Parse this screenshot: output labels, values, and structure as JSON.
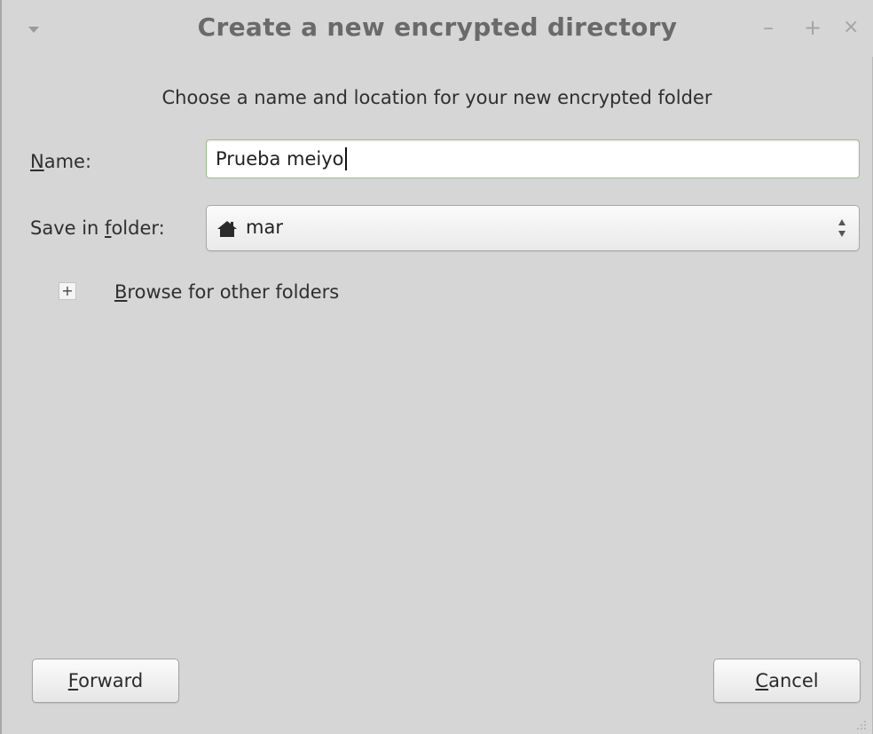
{
  "window": {
    "title": "Create a new encrypted directory",
    "controls": {
      "minimize": "–",
      "maximize": "+",
      "close": "×"
    }
  },
  "dialog": {
    "subtitle": "Choose a name and location for your new encrypted folder",
    "name_field": {
      "label_mnemonic": "N",
      "label_rest": "ame:",
      "value": "Prueba meiyo"
    },
    "folder_field": {
      "label_prefix": "Save in ",
      "label_mnemonic": "f",
      "label_rest": "older:",
      "selected": "mar",
      "icon": "home-icon"
    },
    "browse": {
      "expander": "+",
      "label_mnemonic": "B",
      "label_rest": "rowse for other folders"
    }
  },
  "buttons": {
    "forward": {
      "mnemonic": "F",
      "rest": "orward"
    },
    "cancel": {
      "mnemonic": "C",
      "rest": "ancel"
    }
  }
}
